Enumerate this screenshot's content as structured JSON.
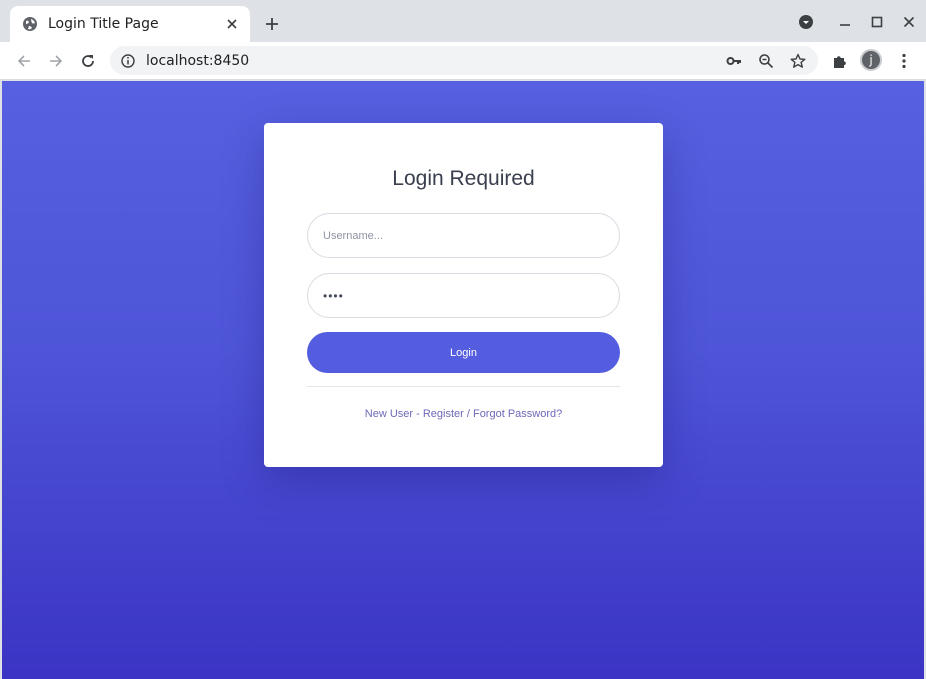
{
  "browser": {
    "tab_title": "Login Title Page",
    "url": "localhost:8450",
    "profile_initial": "j",
    "icons": [
      "globe-icon",
      "close-icon",
      "plus-icon",
      "profile-dropdown-icon",
      "minimize-icon",
      "maximize-icon",
      "window-close-icon",
      "back-icon",
      "forward-icon",
      "reload-icon",
      "info-icon",
      "key-icon",
      "zoom-icon",
      "star-icon",
      "puzzle-icon",
      "kebab-menu-icon"
    ]
  },
  "login": {
    "title": "Login Required",
    "username_placeholder": "Username...",
    "password_value": "••••",
    "button_label": "Login",
    "link_register": "New User - Register",
    "link_separator": " / ",
    "link_forgot": "Forgot Password?"
  },
  "colors": {
    "accent": "#545ddf",
    "background_top": "#5660e0",
    "background_bottom": "#3b34c4",
    "link": "#6d68b8"
  }
}
